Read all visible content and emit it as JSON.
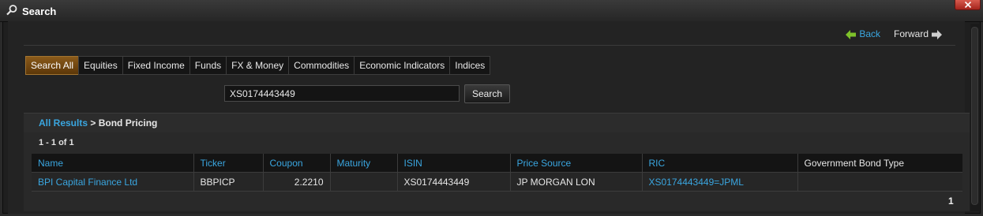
{
  "window": {
    "title": "Search"
  },
  "nav": {
    "back_label": "Back",
    "forward_label": "Forward"
  },
  "tabs": [
    "Search All",
    "Equities",
    "Fixed Income",
    "Funds",
    "FX & Money",
    "Commodities",
    "Economic Indicators",
    "Indices"
  ],
  "active_tab": "Search All",
  "search": {
    "value": "XS0174443449",
    "button_label": "Search"
  },
  "breadcrumb": {
    "root": "All Results",
    "separator": " > ",
    "current": "Bond Pricing"
  },
  "results": {
    "count_text": "1 - 1 of 1",
    "columns": [
      "Name",
      "Ticker",
      "Coupon",
      "Maturity",
      "ISIN",
      "Price Source",
      "RIC",
      "Government Bond Type"
    ],
    "rows": [
      [
        "BPI Capital Finance Ltd",
        "BBPICP",
        "2.2210",
        "",
        "XS0174443449",
        "JP MORGAN LON",
        "XS0174443449=JPML",
        ""
      ]
    ],
    "page": "1"
  },
  "colors": {
    "link": "#3aa6e0",
    "active_tab": "#8a5a1a",
    "nav_arrow_back": "#7ec22a"
  }
}
